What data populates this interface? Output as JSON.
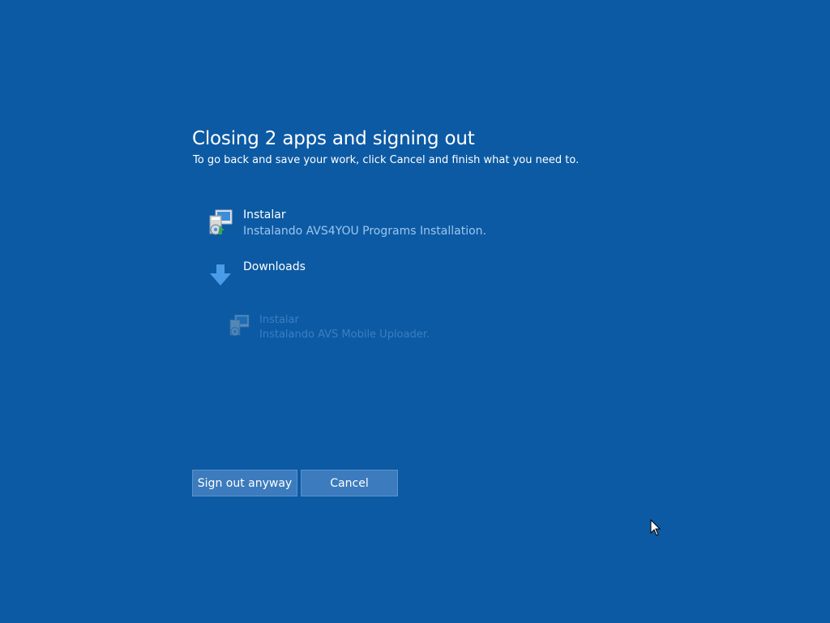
{
  "dialog": {
    "title": "Closing 2 apps and signing out",
    "subtitle": "To go back and save your work, click Cancel and finish what you need to."
  },
  "apps": [
    {
      "name": "Instalar",
      "description": "Instalando AVS4YOU Programs Installation.",
      "icon": "installer-icon"
    },
    {
      "name": "Downloads",
      "description": "",
      "icon": "download-arrow-icon"
    },
    {
      "name": "Instalar",
      "description": "Instalando AVS Mobile Uploader.",
      "icon": "installer-icon"
    }
  ],
  "buttons": {
    "sign_out": "Sign out anyway",
    "cancel": "Cancel"
  },
  "colors": {
    "background": "#0c5aa4",
    "button": "#3c7bbd",
    "accent_text": "#9cc6ef"
  }
}
